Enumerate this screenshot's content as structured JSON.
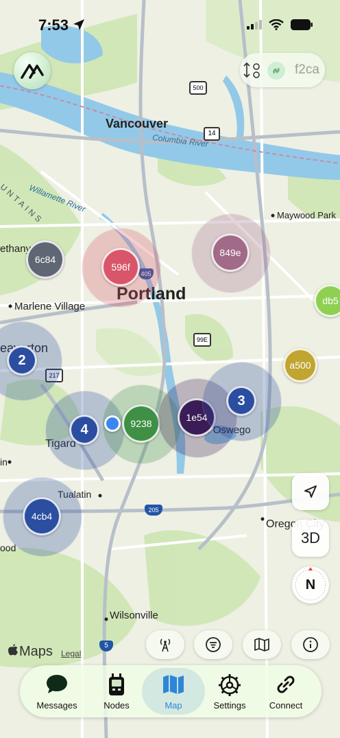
{
  "status_bar": {
    "time": "7:53"
  },
  "header": {
    "node_id": "f2ca"
  },
  "map": {
    "labels": {
      "vancouver": "Vancouver",
      "columbia_river": "Columbia River",
      "willamette_river": "Willamette River",
      "tains": "UNTAINS",
      "maywood": "Maywood Park",
      "bethany": "ethany",
      "portland": "Portland",
      "marlene": "Marlene Village",
      "beaverton": "Beaverton",
      "tigard": "Tigard",
      "lake_oswego": "Lake Oswego",
      "tin": "in",
      "tualatin": "Tualatin",
      "oregon_city": "Oregon City",
      "ood": "ood",
      "wilsonville": "Wilsonville"
    },
    "shields": {
      "i500": "500",
      "r14": "14",
      "i405": "405",
      "r99e": "99E",
      "r217": "217",
      "i205": "205",
      "i5": "5"
    },
    "node_clusters": [
      {
        "label": "6c84",
        "color": "#5f6775",
        "halo": false
      },
      {
        "label": "596f",
        "color": "#d9566a",
        "halo": true
      },
      {
        "label": "849e",
        "color": "#a16a88",
        "halo": true
      },
      {
        "label": "db5",
        "color": "#8fd053",
        "halo": false
      },
      {
        "label": "2",
        "color": "#2b4ea0",
        "halo": true
      },
      {
        "label": "a500",
        "color": "#c0a531",
        "halo": false
      },
      {
        "label": "4",
        "color": "#2b4ea0",
        "halo": true
      },
      {
        "label": "9238",
        "color": "#3f8f45",
        "halo": true
      },
      {
        "label": "1e54",
        "color": "#3a1d56",
        "halo": true
      },
      {
        "label": "3",
        "color": "#2b4ea0",
        "halo": true
      },
      {
        "label": "4cb4",
        "color": "#2b4ea0",
        "halo": true
      }
    ]
  },
  "controls": {
    "view_3d": "3D",
    "compass": "N"
  },
  "attribution": {
    "maps": "Maps",
    "legal": "Legal"
  },
  "tabs": [
    {
      "label": "Messages",
      "active": false
    },
    {
      "label": "Nodes",
      "active": false
    },
    {
      "label": "Map",
      "active": true
    },
    {
      "label": "Settings",
      "active": false
    },
    {
      "label": "Connect",
      "active": false
    }
  ],
  "colors": {
    "accent": "#2f86d6",
    "water": "#8fc6e6",
    "park": "#cfe8b8"
  }
}
